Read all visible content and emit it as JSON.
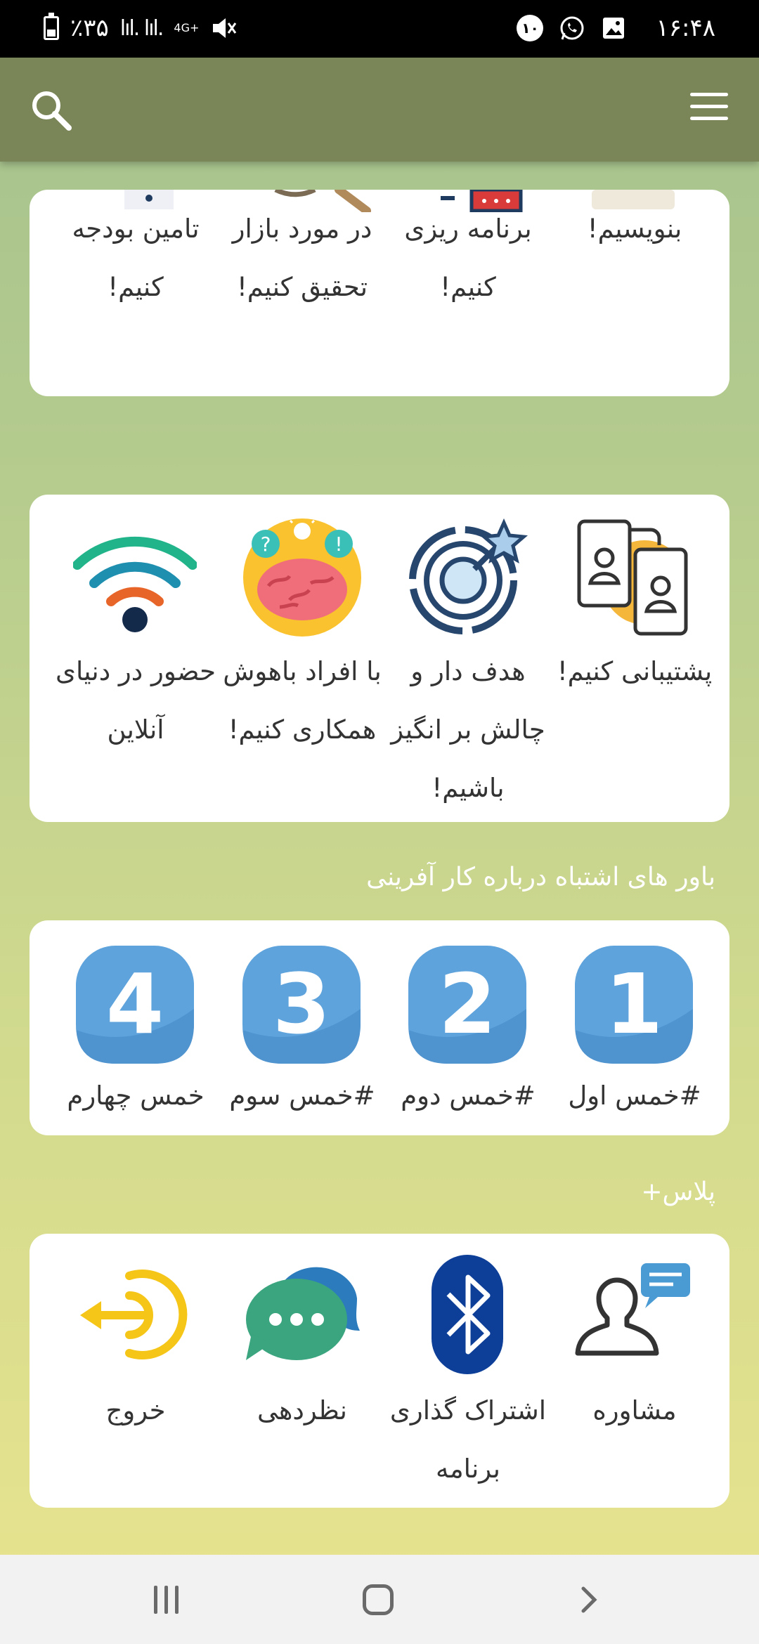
{
  "status_bar": {
    "time": "۱۶:۴۸",
    "battery": "٪۳۵",
    "network": "4G+",
    "notification_count": "۱۰"
  },
  "section1": {
    "items": [
      {
        "label": "بنویسیم!"
      },
      {
        "label": "برنامه ریزی کنیم!"
      },
      {
        "label": "در مورد بازار تحقیق کنیم!"
      },
      {
        "label": "تامین بودجه کنیم!"
      }
    ]
  },
  "section2": {
    "items": [
      {
        "label": "پشتیبانی کنیم!",
        "icon": "mobile-support-icon"
      },
      {
        "label": "هدف دار و چالش بر انگیز باشیم!",
        "icon": "target-goal-icon"
      },
      {
        "label": "با افراد باهوش همکاری کنیم!",
        "icon": "brain-icon"
      },
      {
        "label": "حضور در دنیای آنلاین",
        "icon": "wifi-icon"
      }
    ]
  },
  "section3": {
    "title": "باور های اشتباه درباره کار آفرینی",
    "items": [
      {
        "number": "1",
        "label": "#خمس اول"
      },
      {
        "number": "2",
        "label": "#خمس دوم"
      },
      {
        "number": "3",
        "label": "#خمس سوم"
      },
      {
        "number": "4",
        "label": "خمس چهارم"
      }
    ],
    "badge_color": "#5ea3dc"
  },
  "section4": {
    "title": "پلاس+",
    "items": [
      {
        "label": "مشاوره",
        "icon": "consult-user-icon"
      },
      {
        "label": "اشتراک گذاری برنامه",
        "icon": "bluetooth-icon"
      },
      {
        "label": "نظردهی",
        "icon": "chat-bubbles-icon"
      },
      {
        "label": "خروج",
        "icon": "exit-icon"
      }
    ]
  },
  "colors": {
    "topbar": "#7a8558",
    "bluetooth": "#0d3f99",
    "chat": "#3aa57f",
    "exit": "#f5c518",
    "consult_bubble": "#4a9bd3"
  }
}
